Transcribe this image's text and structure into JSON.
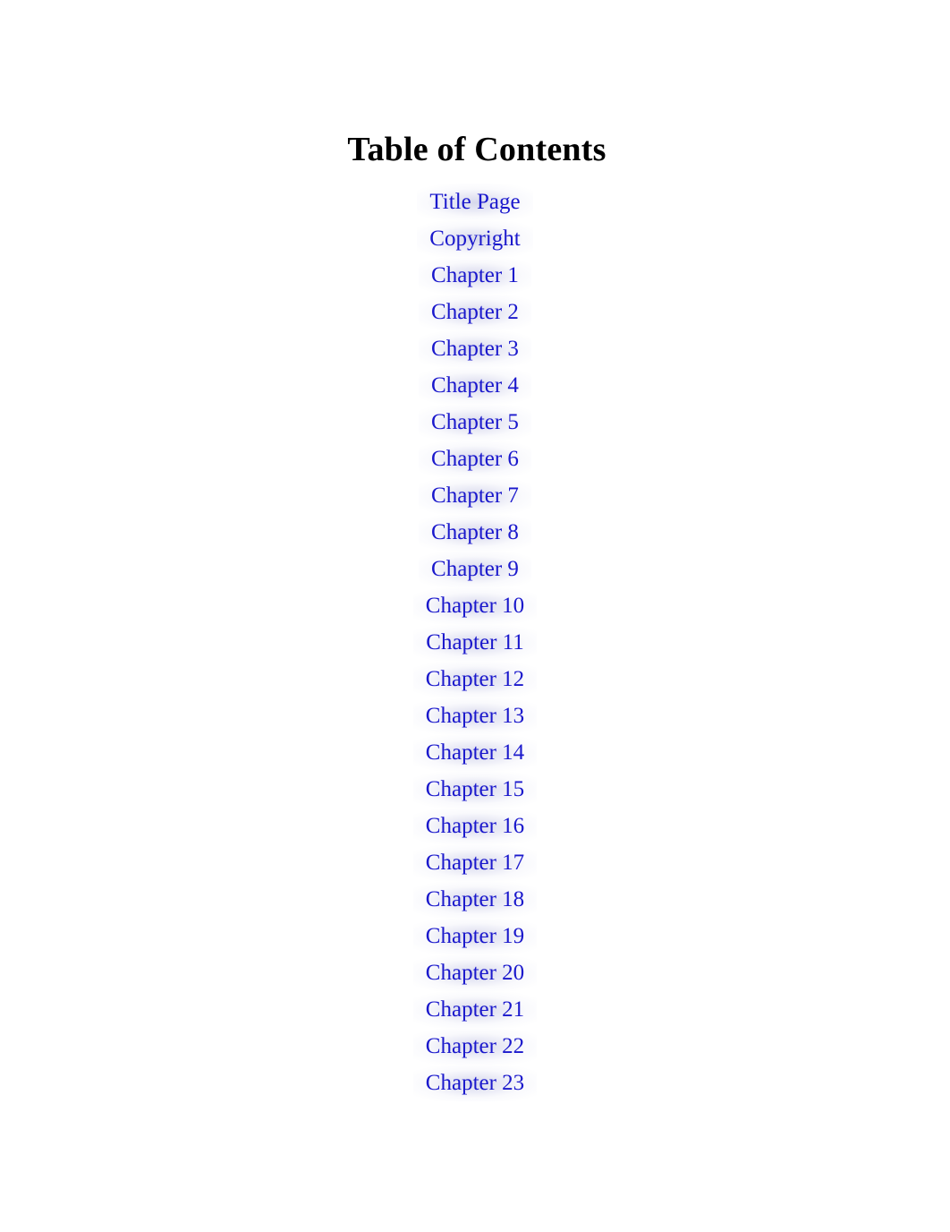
{
  "document": {
    "heading": "Table of Contents",
    "text_color": "#000000",
    "link_color": "#1a18cc",
    "background_color": "#ffffff",
    "highlight_color": "#d0d2e8"
  },
  "toc": {
    "entries": [
      {
        "label": "Title Page"
      },
      {
        "label": "Copyright"
      },
      {
        "label": "Chapter 1"
      },
      {
        "label": "Chapter 2"
      },
      {
        "label": "Chapter 3"
      },
      {
        "label": "Chapter 4"
      },
      {
        "label": "Chapter 5"
      },
      {
        "label": "Chapter 6"
      },
      {
        "label": "Chapter 7"
      },
      {
        "label": "Chapter 8"
      },
      {
        "label": "Chapter 9"
      },
      {
        "label": "Chapter 10"
      },
      {
        "label": "Chapter 11"
      },
      {
        "label": "Chapter 12"
      },
      {
        "label": "Chapter 13"
      },
      {
        "label": "Chapter 14"
      },
      {
        "label": "Chapter 15"
      },
      {
        "label": "Chapter 16"
      },
      {
        "label": "Chapter 17"
      },
      {
        "label": "Chapter 18"
      },
      {
        "label": "Chapter 19"
      },
      {
        "label": "Chapter 20"
      },
      {
        "label": "Chapter 21"
      },
      {
        "label": "Chapter 22"
      },
      {
        "label": "Chapter 23"
      }
    ]
  }
}
